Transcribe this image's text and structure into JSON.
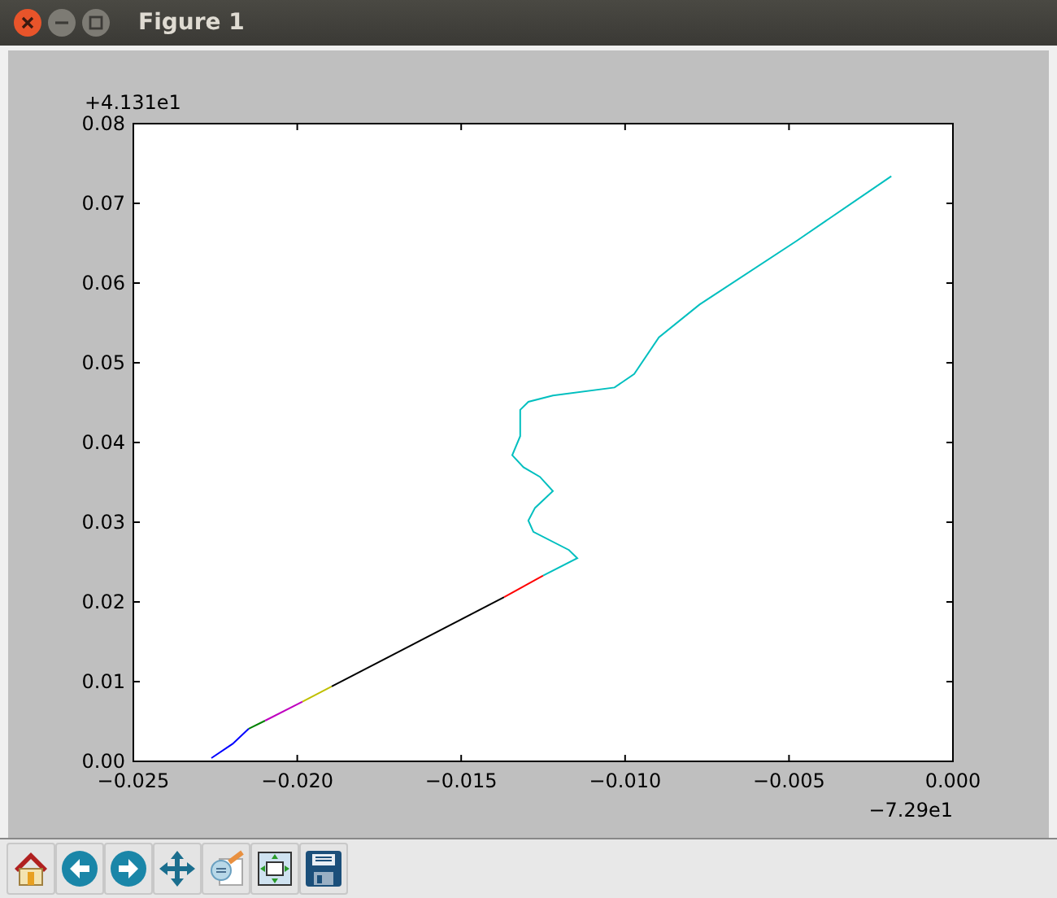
{
  "window": {
    "title": "Figure 1"
  },
  "figure": {
    "y_offset_label": "+4.131e1",
    "x_offset_label": "−7.29e1",
    "chart_data": {
      "type": "line",
      "x": [
        -0.02262,
        -0.02197,
        -0.02148,
        -0.02098,
        -0.01984,
        -0.01895,
        -0.01369,
        -0.0125,
        -0.01146,
        -0.01171,
        -0.0128,
        -0.01295,
        -0.01275,
        -0.0122,
        -0.0126,
        -0.0131,
        -0.01344,
        -0.0132,
        -0.0132,
        -0.01295,
        -0.0122,
        -0.01032,
        -0.00972,
        -0.00897,
        -0.00773,
        -0.00476,
        -0.00188
      ],
      "series": [
        {
          "color": "#0000ff",
          "values": [
            0.0004,
            0.0022,
            0.0041,
            null,
            null,
            null,
            null,
            null,
            null,
            null,
            null,
            null,
            null,
            null,
            null,
            null,
            null,
            null,
            null,
            null,
            null,
            null,
            null,
            null,
            null,
            null,
            null
          ]
        },
        {
          "color": "#008000",
          "values": [
            null,
            null,
            0.0041,
            0.0051,
            null,
            null,
            null,
            null,
            null,
            null,
            null,
            null,
            null,
            null,
            null,
            null,
            null,
            null,
            null,
            null,
            null,
            null,
            null,
            null,
            null,
            null,
            null
          ]
        },
        {
          "color": "#bf00bf",
          "values": [
            null,
            null,
            null,
            0.0051,
            0.0075,
            null,
            null,
            null,
            null,
            null,
            null,
            null,
            null,
            null,
            null,
            null,
            null,
            null,
            null,
            null,
            null,
            null,
            null,
            null,
            null,
            null,
            null
          ]
        },
        {
          "color": "#bfbf00",
          "values": [
            null,
            null,
            null,
            null,
            0.0075,
            0.0094,
            null,
            null,
            null,
            null,
            null,
            null,
            null,
            null,
            null,
            null,
            null,
            null,
            null,
            null,
            null,
            null,
            null,
            null,
            null,
            null,
            null
          ]
        },
        {
          "color": "#000000",
          "values": [
            null,
            null,
            null,
            null,
            null,
            0.0094,
            0.0206,
            null,
            null,
            null,
            null,
            null,
            null,
            null,
            null,
            null,
            null,
            null,
            null,
            null,
            null,
            null,
            null,
            null,
            null,
            null,
            null
          ]
        },
        {
          "color": "#ff0000",
          "values": [
            null,
            null,
            null,
            null,
            null,
            null,
            0.0206,
            0.0233,
            null,
            null,
            null,
            null,
            null,
            null,
            null,
            null,
            null,
            null,
            null,
            null,
            null,
            null,
            null,
            null,
            null,
            null,
            null
          ]
        },
        {
          "color": "#00bfbf",
          "values": [
            null,
            null,
            null,
            null,
            null,
            null,
            null,
            0.0233,
            0.0255,
            0.0265,
            0.0288,
            0.0302,
            0.0318,
            0.0339,
            0.0357,
            0.0369,
            0.0384,
            0.0408,
            0.0441,
            0.0451,
            0.0459,
            0.0469,
            0.0486,
            0.0532,
            0.0573,
            0.0653,
            0.0734
          ]
        }
      ],
      "xlim": [
        -0.025,
        0
      ],
      "ylim": [
        0,
        0.08
      ],
      "xticks": [
        {
          "value": -0.025,
          "label": "−0.025"
        },
        {
          "value": -0.02,
          "label": "−0.020"
        },
        {
          "value": -0.015,
          "label": "−0.015"
        },
        {
          "value": -0.01,
          "label": "−0.010"
        },
        {
          "value": -0.005,
          "label": "−0.005"
        },
        {
          "value": 0,
          "label": "0.000"
        }
      ],
      "yticks": [
        {
          "value": 0,
          "label": "0.00"
        },
        {
          "value": 0.01,
          "label": "0.01"
        },
        {
          "value": 0.02,
          "label": "0.02"
        },
        {
          "value": 0.03,
          "label": "0.03"
        },
        {
          "value": 0.04,
          "label": "0.04"
        },
        {
          "value": 0.05,
          "label": "0.05"
        },
        {
          "value": 0.06,
          "label": "0.06"
        },
        {
          "value": 0.07,
          "label": "0.07"
        },
        {
          "value": 0.08,
          "label": "0.08"
        }
      ]
    }
  },
  "toolbar": [
    {
      "kind": "home"
    },
    {
      "kind": "back"
    },
    {
      "kind": "forward"
    },
    {
      "kind": "pan"
    },
    {
      "kind": "zoom"
    },
    {
      "kind": "subplots"
    },
    {
      "kind": "save"
    }
  ]
}
